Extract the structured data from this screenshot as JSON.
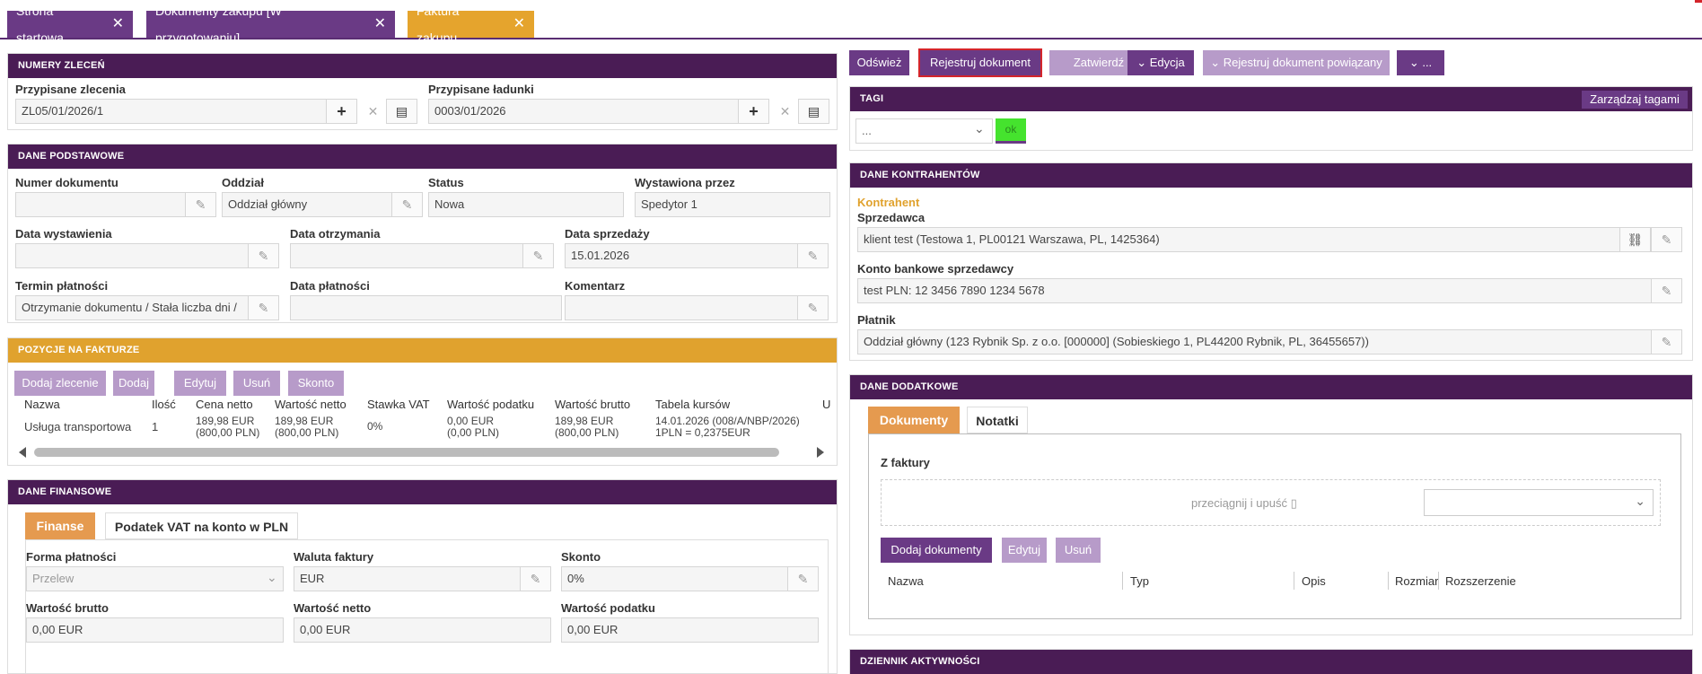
{
  "tabs": [
    {
      "label": "Strona startowa"
    },
    {
      "label": "Dokumenty zakupu [W przygotowaniu]"
    },
    {
      "label": "Faktura zakupu"
    }
  ],
  "orders": {
    "header": "NUMERY ZLECEŃ",
    "assigned_orders_label": "Przypisane zlecenia",
    "assigned_orders_value": "ZL05/01/2026/1",
    "assigned_loads_label": "Przypisane ładunki",
    "assigned_loads_value": "0003/01/2026"
  },
  "basic": {
    "header": "DANE PODSTAWOWE",
    "doc_number_label": "Numer dokumentu",
    "doc_number_value": "",
    "branch_label": "Oddział",
    "branch_value": "Oddział główny",
    "status_label": "Status",
    "status_value": "Nowa",
    "issued_by_label": "Wystawiona przez",
    "issued_by_value": "Spedytor 1",
    "issue_date_label": "Data wystawienia",
    "issue_date_value": "",
    "receipt_date_label": "Data otrzymania",
    "receipt_date_value": "",
    "sale_date_label": "Data sprzedaży",
    "sale_date_value": "15.01.2026",
    "payment_term_label": "Termin płatności",
    "payment_term_value": "Otrzymanie dokumentu / Stała liczba dni /",
    "payment_date_label": "Data płatności",
    "payment_date_value": "",
    "comment_label": "Komentarz",
    "comment_value": ""
  },
  "items": {
    "header": "POZYCJE NA FAKTURZE",
    "buttons": [
      "Dodaj zlecenie",
      "Dodaj",
      "Edytuj",
      "Usuń",
      "Skonto"
    ],
    "columns": [
      "Nazwa",
      "Ilość",
      "Cena netto",
      "Wartość netto",
      "Stawka VAT",
      "Wartość podatku",
      "Wartość brutto",
      "Tabela kursów",
      "U"
    ],
    "row": {
      "name": "Usługa transportowa",
      "qty": "1",
      "net_price_1": "189,98 EUR",
      "net_price_2": "(800,00 PLN)",
      "net_value_1": "189,98 EUR",
      "net_value_2": "(800,00 PLN)",
      "vat": "0%",
      "tax_1": "0,00 EUR",
      "tax_2": "(0,00 PLN)",
      "gross_1": "189,98 EUR",
      "gross_2": "(800,00 PLN)",
      "rate_1": "14.01.2026 (008/A/NBP/2026)",
      "rate_2": "1PLN = 0,2375EUR"
    }
  },
  "finance": {
    "header": "DANE FINANSOWE",
    "tab_finance": "Finanse",
    "tab_vat": "Podatek VAT na konto w PLN",
    "payment_form_label": "Forma płatności",
    "payment_form_value": "Przelew",
    "currency_label": "Waluta faktury",
    "currency_value": "EUR",
    "discount_label": "Skonto",
    "discount_value": "0%",
    "gross_label": "Wartość brutto",
    "gross_value": "0,00 EUR",
    "net_label": "Wartość netto",
    "net_value": "0,00 EUR",
    "tax_label": "Wartość podatku",
    "tax_value": "0,00 EUR"
  },
  "toolbar": {
    "refresh": "Odśwież",
    "register": "Rejestruj dokument",
    "approve": "Zatwierdź",
    "edit": "Edycja",
    "register_related": "Rejestruj dokument powiązany",
    "more": "..."
  },
  "tags": {
    "header": "TAGI",
    "manage": "Zarządzaj tagami",
    "select_value": "...",
    "ok": "ok"
  },
  "contractors": {
    "header": "DANE KONTRAHENTÓW",
    "section": "Kontrahent",
    "seller_label": "Sprzedawca",
    "seller_value": "klient test (Testowa 1, PL00121 Warszawa, PL, 1425364)",
    "bank_label": "Konto bankowe sprzedawcy",
    "bank_value": "test PLN: 12 3456 7890 1234 5678",
    "payer_label": "Płatnik",
    "payer_value": "Oddział główny (123 Rybnik Sp. z o.o. [000000] (Sobieskiego 1, PL44200 Rybnik, PL, 36455657))"
  },
  "extra": {
    "header": "DANE DODATKOWE",
    "tab_docs": "Dokumenty",
    "tab_notes": "Notatki",
    "from_invoice": "Z faktury",
    "dropzone": "przeciągnij i upuść",
    "buttons": [
      "Dodaj dokumenty",
      "Edytuj",
      "Usuń"
    ],
    "columns": [
      "Nazwa",
      "Typ",
      "Opis",
      "Rozmiar",
      "Rozszerzenie"
    ]
  },
  "activity": {
    "header": "DZIENNIK AKTYWNOŚCI"
  }
}
